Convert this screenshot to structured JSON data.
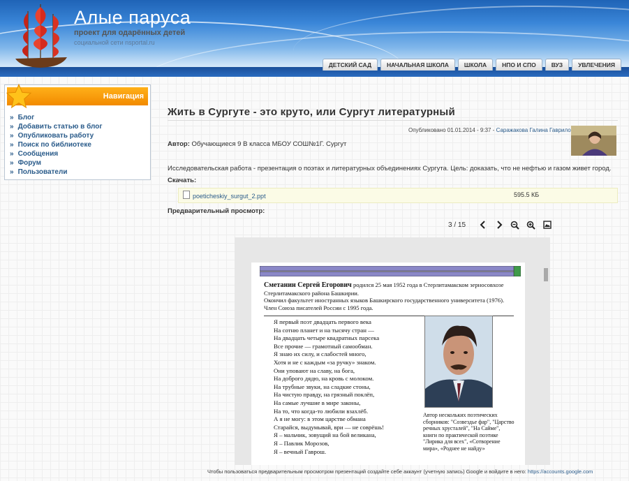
{
  "header": {
    "site_title": "Алые паруса",
    "subtitle": "проект для одарённых детей",
    "subtitle2": "социальной сети nsportal.ru",
    "tabs": [
      "ДЕТСКИЙ САД",
      "НАЧАЛЬНАЯ ШКОЛА",
      "ШКОЛА",
      "НПО И СПО",
      "ВУЗ",
      "УВЛЕЧЕНИЯ"
    ]
  },
  "sidebar": {
    "heading": "Навигация",
    "bullet": "»",
    "items": [
      "Блог",
      "Добавить статью в блог",
      "Опубликовать работу",
      "Поиск по библиотеке",
      "Сообщения",
      "Форум",
      "Пользователи"
    ]
  },
  "article": {
    "title": "Жить в Сургуте - это круто, или Сургут литературный",
    "published": "Опубликовано 01.01.2014 - 9:37 - ",
    "published_author": "Саражакова Галина Гавриловна",
    "author_label": "Автор:",
    "author_value": "Обучающиеся 9 В класса МБОУ СОШ№1Г. Сургут",
    "description": "Исследовательская работа - презентация о поэтах и литературных объединениях Сургута. Цель: доказать, что не нефтью и газом живет город.",
    "download_label": "Скачать:",
    "file_name": "poeticheskiy_surgut_2.ppt",
    "file_size": "595.5 КБ",
    "preview_label": "Предварительный просмотр:"
  },
  "viewer": {
    "page_counter": "3 / 15",
    "buttons": [
      "prev",
      "next",
      "zoom-out",
      "zoom-in",
      "fullscreen"
    ]
  },
  "slide": {
    "name": "Сметанин Сергей Егорович",
    "intro1": " родился 25 мая 1952 года в Стерлитамакском зерносовхозе",
    "intro2": "Стерлитамакского района Башкирии.",
    "intro3": "Окончил факультет иностранных языков Башкирского государственного университета (1976).",
    "intro4": "Член Союза писателей России с 1995 года.",
    "poem": [
      "Я первый поэт двадцать первого века",
      "На сотню планет и на тысячу стран —",
      "На двадцать четыре квадратных парсека",
      "Все прочие — грамотный самообман.",
      "Я знаю их силу, и слабостей много,",
      "Хотя и не с каждым «за ручку» знаком.",
      "Они уповают на славу, на бога,",
      "На доброго дядю, на кровь с молоком.",
      "На трубные звуки, на сладкие стоны,",
      "На чистую правду, на грязный поклёп,",
      "На самые лучшие в мире законы,",
      "На то, что когда-то любили взахлёб.",
      "А я не могу: в этом царстве обмана",
      "Старайся, выдумывай, ври — не соврёшь!",
      "Я – мальчик, зовущий на бой великана,",
      "Я – Павлик Морозов,",
      "Я – вечный Гаврош."
    ],
    "caption": "Автор нескольких поэтических сборников: \"Созвездье фар\", \"Царство речных хрусталей\", \"На Сайме\", книги по практической поэтике \"Лирика для всех\", «Сотворение мира», «Роднее не найду»"
  },
  "notice": {
    "text": "Чтобы пользоваться предварительным просмотром презентаций создайте себе аккаунт (учетную запись) Google и войдите в него: ",
    "link": "https://accounts.google.com"
  },
  "colors": {
    "accent": "#f28a00",
    "link": "#2a5b8a",
    "header": "#2b6cc0"
  }
}
